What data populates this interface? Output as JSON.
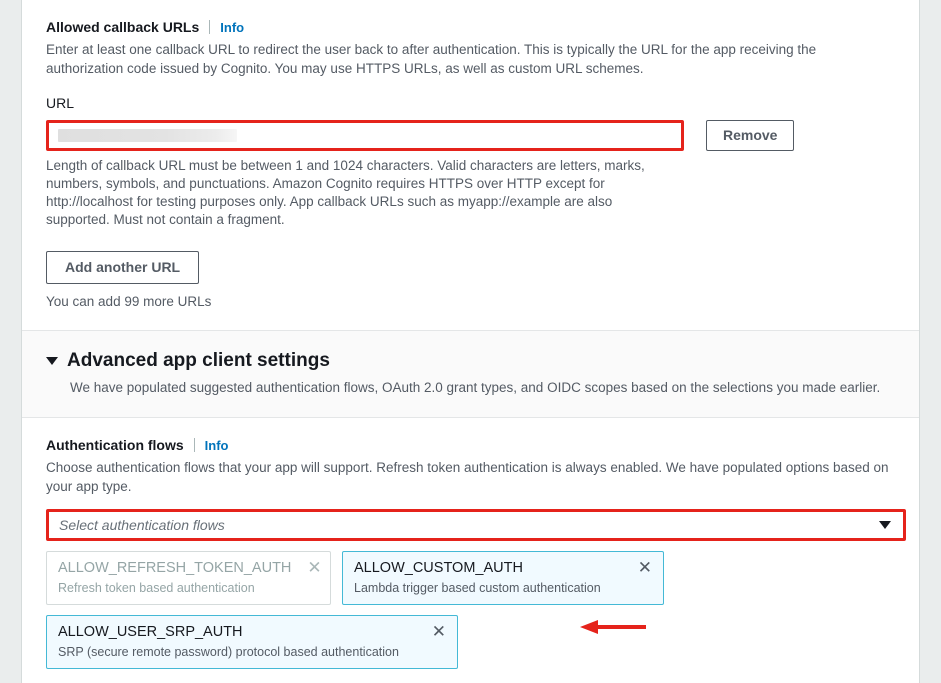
{
  "callback_section": {
    "label": "Allowed callback URLs",
    "info_label": "Info",
    "description": "Enter at least one callback URL to redirect the user back to after authentication. This is typically the URL for the app receiving the authorization code issued by Cognito. You may use HTTPS URLs, as well as custom URL schemes.",
    "url_field_label": "URL",
    "url_value": "",
    "url_placeholder": "",
    "remove_label": "Remove",
    "constraint_text": "Length of callback URL must be between 1 and 1024 characters. Valid characters are letters, marks, numbers, symbols, and punctuations. Amazon Cognito requires HTTPS over HTTP except for http://localhost for testing purposes only. App callback URLs such as myapp://example are also supported. Must not contain a fragment.",
    "add_url_label": "Add another URL",
    "add_hint": "You can add 99 more URLs"
  },
  "advanced_section": {
    "title": "Advanced app client settings",
    "description": "We have populated suggested authentication flows, OAuth 2.0 grant types, and OIDC scopes based on the selections you made earlier.",
    "expanded_icon": "caret-down-icon"
  },
  "auth_flows": {
    "label": "Authentication flows",
    "info_label": "Info",
    "description": "Choose authentication flows that your app will support. Refresh token authentication is always enabled. We have populated options based on your app type.",
    "select_placeholder": "Select authentication flows",
    "select_caret_icon": "caret-down-icon",
    "selected": [
      {
        "name": "ALLOW_REFRESH_TOKEN_AUTH",
        "description": "Refresh token based authentication",
        "disabled": true,
        "remove_icon": "close-icon"
      },
      {
        "name": "ALLOW_CUSTOM_AUTH",
        "description": "Lambda trigger based custom authentication",
        "disabled": false,
        "remove_icon": "close-icon"
      },
      {
        "name": "ALLOW_USER_SRP_AUTH",
        "description": "SRP (secure remote password) protocol based authentication",
        "disabled": false,
        "remove_icon": "close-icon"
      }
    ]
  },
  "annotations": {
    "highlight_color": "#e5231b",
    "arrow_color": "#e5231b",
    "arrow_direction": "left"
  },
  "colors": {
    "accent_link": "#0073bb",
    "chip_active_border": "#44b9d6",
    "chip_active_bg": "#f1faff",
    "page_bg": "#eaeded",
    "panel_bg": "#ffffff"
  }
}
